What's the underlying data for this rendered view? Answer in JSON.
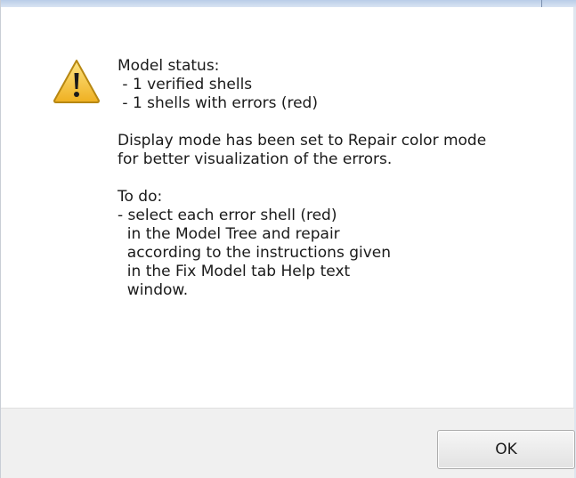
{
  "dialog": {
    "icon": "warning-icon",
    "message_lines": [
      "Model status:",
      " - 1 verified shells",
      " - 1 shells with errors (red)",
      "",
      "Display mode has been set to Repair color mode",
      "for better visualization of the errors.",
      "",
      "To do:",
      "- select each error shell (red)",
      "  in the Model Tree and repair",
      "  according to the instructions given",
      "  in the Fix Model tab Help text",
      "  window."
    ],
    "ok_label": "OK"
  },
  "colors": {
    "warning_fill": "#f5c542",
    "footer_bg": "#f0f0f0"
  }
}
